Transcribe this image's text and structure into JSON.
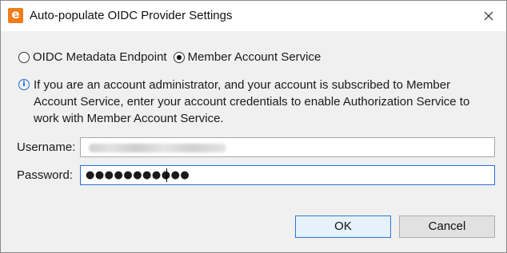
{
  "window": {
    "title": "Auto-populate OIDC Provider Settings",
    "app_icon_letter": "e"
  },
  "source_options": [
    {
      "label": "OIDC Metadata Endpoint",
      "checked": false
    },
    {
      "label": "Member Account Service",
      "checked": true
    }
  ],
  "info": {
    "text": "If you are an account administrator, and your account is subscribed to Member Account Service, enter your account credentials to enable Authorization Service to work with Member Account Service."
  },
  "form": {
    "username_label": "Username:",
    "password_label": "Password:",
    "password_mask": "●●●●●●●●●●●"
  },
  "buttons": {
    "ok_label": "OK",
    "cancel_label": "Cancel"
  },
  "colors": {
    "accent": "#2b78d4",
    "app_icon": "#f07c1b",
    "info_icon": "#1e6fd0"
  }
}
